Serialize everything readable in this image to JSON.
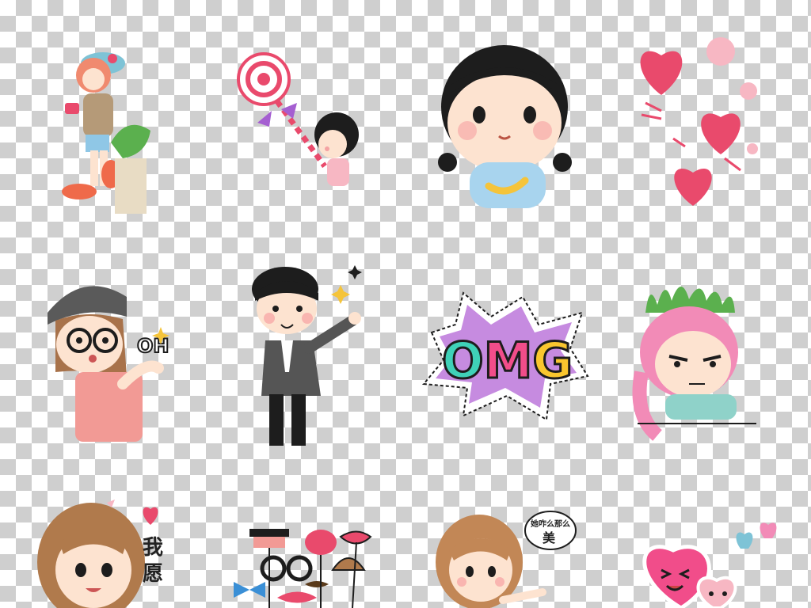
{
  "stickers": {
    "omg": {
      "text": "OMG",
      "colors": [
        "#3fd1b8",
        "#f14d8a",
        "#f9c62e"
      ],
      "burst": "#c68be0"
    },
    "oh": {
      "text": "OH"
    },
    "wish": {
      "line1": "我",
      "line2": "愿"
    },
    "bubble": {
      "line1": "她咋么那么",
      "line2": "美"
    }
  },
  "palette": {
    "checker": "#cfcfcf",
    "heart_pink": "#e94a6c",
    "skin": "#fde3d0",
    "hair_black": "#1d1d1d",
    "hair_brown": "#b07a4c"
  }
}
